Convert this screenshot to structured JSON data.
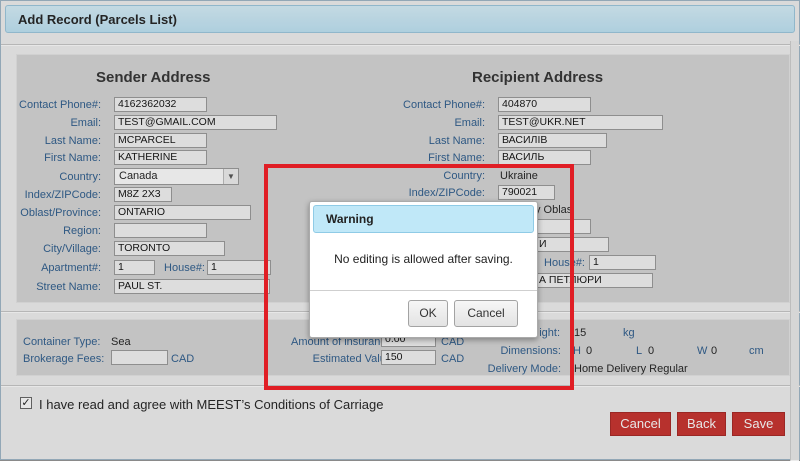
{
  "dialog": {
    "title": "Add Record (Parcels List)"
  },
  "sender": {
    "heading": "Sender Address",
    "fields": [
      {
        "label": "Contact Phone#:",
        "value": "4162362032"
      },
      {
        "label": "Email:",
        "value": "TEST@GMAIL.COM"
      },
      {
        "label": "Last Name:",
        "value": "MCPARCEL"
      },
      {
        "label": "First Name:",
        "value": "KATHERINE"
      },
      {
        "label": "Country:",
        "value": "Canada"
      },
      {
        "label": "Index/ZIPCode:",
        "value": "M8Z 2X3"
      },
      {
        "label": "Oblast/Province:",
        "value": "ONTARIO"
      },
      {
        "label": "Region:",
        "value": ""
      },
      {
        "label": "City/Village:",
        "value": "TORONTO"
      },
      {
        "label": "Apartment#:",
        "value": "1"
      },
      {
        "label": "House#:",
        "value": "1"
      },
      {
        "label": "Street Name:",
        "value": "PAUL ST."
      }
    ]
  },
  "recipient": {
    "heading": "Recipient Address",
    "fields": [
      {
        "label": "Contact Phone#:",
        "value": "404870"
      },
      {
        "label": "Email:",
        "value": "TEST@UKR.NET"
      },
      {
        "label": "Last Name:",
        "value": "ВАСИЛІВ"
      },
      {
        "label": "First Name:",
        "value": "ВАСИЛЬ"
      },
      {
        "label": "Country:",
        "value": "Ukraine"
      },
      {
        "label": "Index/ZIPCode:",
        "value": "790021"
      },
      {
        "label": "Oblast_partial",
        "value": "y Oblas"
      },
      {
        "label": "City_partial",
        "value": "И"
      },
      {
        "label": "House#:",
        "value": "1"
      },
      {
        "label": "Street_partial",
        "value": "А ПЕТЛЮРИ"
      }
    ]
  },
  "shipping": {
    "container_type_label": "Container Type:",
    "container_type_value": "Sea",
    "brokerage_label": "Brokerage Fees:",
    "brokerage_value": "",
    "brokerage_unit": "CAD",
    "insurance_label": "Amount of insurance:",
    "insurance_value": "0.00",
    "insurance_unit": "CAD",
    "estimated_label": "Estimated Value:",
    "estimated_value": "150",
    "estimated_unit": "CAD",
    "weight_label_partial": "ight:",
    "weight_value": "15",
    "weight_unit": "kg",
    "dimensions_label": "Dimensions:",
    "dim_h_label": "H",
    "dim_h": "0",
    "dim_l_label": "L",
    "dim_l": "0",
    "dim_w_label": "W",
    "dim_w": "0",
    "dim_unit": "cm",
    "delivery_label": "Delivery Mode:",
    "delivery_value": "Home Delivery Regular"
  },
  "agreement": {
    "checked": true,
    "text": "I have read and agree with MEEST’s Conditions of Carriage"
  },
  "buttons": {
    "cancel": "Cancel",
    "back": "Back",
    "save": "Save"
  },
  "modal": {
    "title": "Warning",
    "message": "No editing is allowed after saving.",
    "ok": "OK",
    "cancel": "Cancel"
  },
  "colors": {
    "accent_red": "#c9302c",
    "highlight": "#e01e25",
    "title_bar": "#c0e8f8",
    "label_blue": "#2d5d8e"
  }
}
